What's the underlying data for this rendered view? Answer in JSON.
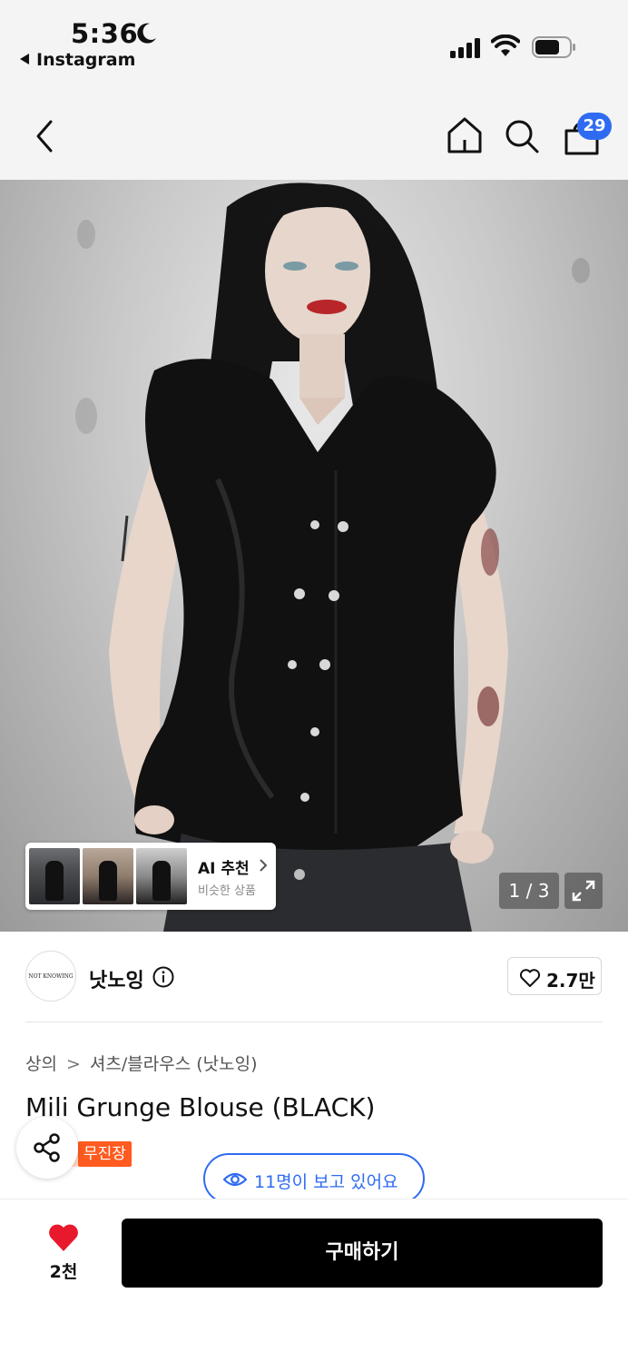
{
  "status_bar": {
    "time": "5:36",
    "back_app": "Instagram"
  },
  "nav": {
    "cart_count": "29",
    "icons": [
      "back-icon",
      "home-icon",
      "search-icon",
      "cart-icon"
    ]
  },
  "hero": {
    "image_counter": "1 / 3",
    "ai_recommend": {
      "title": "AI 추천",
      "subtitle": "비슷한 상품"
    }
  },
  "brand": {
    "logo_text": "NOT KNOWING",
    "name": "낫노잉",
    "likes": "2.7만"
  },
  "product": {
    "breadcrumb": [
      "상의",
      "셔츠/블라우스 (낫노잉)"
    ],
    "title": "Mili Grunge Blouse (BLACK)",
    "tag": "무진장",
    "viewers": "11명이 보고 있어요"
  },
  "bottom_bar": {
    "fav_count": "2천",
    "buy_label": "구매하기"
  },
  "colors": {
    "accent_blue": "#2f6bf2",
    "tag_orange": "#ff5a1f",
    "heart_red": "#e8192c",
    "buy_black": "#000000"
  }
}
